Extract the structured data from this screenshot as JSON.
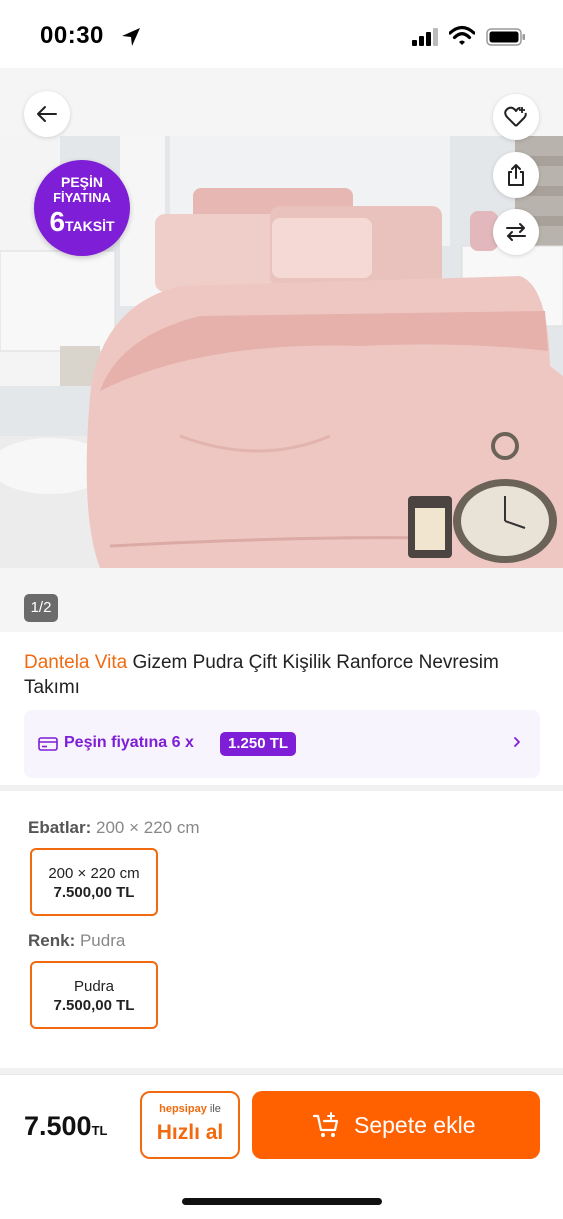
{
  "status_bar": {
    "time": "00:30",
    "icons": [
      "location-arrow-icon",
      "signal-icon",
      "wifi-icon",
      "battery-icon"
    ]
  },
  "gallery": {
    "promo_badge": {
      "line1": "PEŞİN",
      "line2": "FİYATINA",
      "number": "6",
      "line3": "TAKSİT"
    },
    "counter": "1/2",
    "icons": [
      "back-arrow-icon",
      "heart-add-icon",
      "share-icon",
      "compare-arrows-icon"
    ]
  },
  "product": {
    "brand": "Dantela Vita",
    "name": " Gizem Pudra Çift Kişilik Ranforce Nevresim Takımı"
  },
  "installment": {
    "text": "Peşin fiyatına 6 x",
    "amount": "1.250 TL"
  },
  "variants": {
    "size": {
      "label": "Ebatlar:",
      "selected": " 200 × 220 cm",
      "options": [
        {
          "name": "200 × 220 cm",
          "price": "7.500,00 TL"
        }
      ]
    },
    "color": {
      "label": "Renk:",
      "selected": " Pudra",
      "options": [
        {
          "name": "Pudra",
          "price": "7.500,00 TL"
        }
      ]
    }
  },
  "bottom_bar": {
    "price": "7.500",
    "currency": "TL",
    "hepsipay": "hepsipay",
    "hepsipay_suffix": " ile",
    "quick_buy": "Hızlı al",
    "add_to_cart": "Sepete ekle"
  },
  "colors": {
    "brand_orange": "#f16a10",
    "cart_orange": "#ff6000",
    "purple": "#7e1ed6",
    "bedding_pink": "#e9c3c0"
  }
}
